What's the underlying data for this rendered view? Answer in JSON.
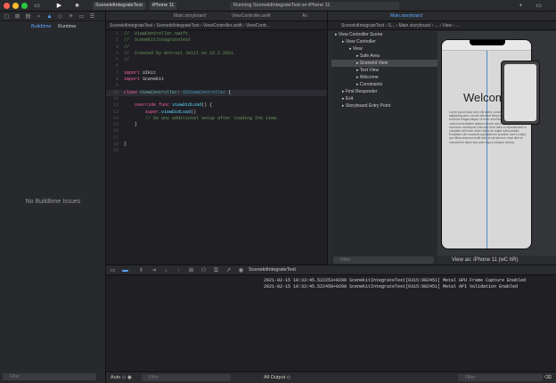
{
  "titlebar": {
    "scheme": "ScenekitIntegrateTest",
    "destination": "iPhone 11",
    "status": "Running ScenekitIntegrateTest on iPhone 11"
  },
  "navigator": {
    "tabs": [
      "Buildtime",
      "Runtime"
    ],
    "empty_message": "No Buildtime Issues",
    "filter_placeholder": "Filter"
  },
  "editor": {
    "tabs": [
      "Main.storyboard",
      "ViewController.swift",
      "As"
    ],
    "breadcrumbs": "ScenekitIntegrateTest  ›  ScenekitIntegrateTest  ›  ViewController.swift  ›  ViewContr...",
    "code": [
      {
        "n": "1",
        "parts": [
          [
            "cmt",
            "//  ViewController.swift"
          ]
        ]
      },
      {
        "n": "2",
        "parts": [
          [
            "cmt",
            "//  ScenekitIntegrateTest"
          ]
        ]
      },
      {
        "n": "3",
        "parts": [
          [
            "cmt",
            "//"
          ]
        ]
      },
      {
        "n": "4",
        "parts": [
          [
            "cmt",
            "//  Created by Antruzi Jalil on 15.2.2021."
          ]
        ]
      },
      {
        "n": "5",
        "parts": [
          [
            "cmt",
            "//"
          ]
        ]
      },
      {
        "n": "6",
        "parts": []
      },
      {
        "n": "7",
        "parts": [
          [
            "kw",
            "import"
          ],
          [
            "pl",
            " UIKit"
          ]
        ]
      },
      {
        "n": "8",
        "parts": [
          [
            "kw",
            "import"
          ],
          [
            "pl",
            " SceneKit"
          ]
        ]
      },
      {
        "n": "9",
        "parts": []
      },
      {
        "n": "10",
        "parts": [
          [
            "kw",
            "class"
          ],
          [
            "pl",
            " "
          ],
          [
            "fn",
            "ViewController"
          ],
          [
            "pl",
            ": "
          ],
          [
            "cls",
            "UIViewController"
          ],
          [
            "pl",
            " {"
          ]
        ],
        "hl": true
      },
      {
        "n": "11",
        "parts": []
      },
      {
        "n": "12",
        "parts": [
          [
            "pl",
            "    "
          ],
          [
            "kw",
            "override"
          ],
          [
            "pl",
            " "
          ],
          [
            "kw",
            "func"
          ],
          [
            "pl",
            " "
          ],
          [
            "typ",
            "viewDidLoad"
          ],
          [
            "pl",
            "() {"
          ]
        ]
      },
      {
        "n": "13",
        "parts": [
          [
            "pl",
            "        "
          ],
          [
            "kw",
            "super"
          ],
          [
            "pl",
            "."
          ],
          [
            "typ",
            "viewDidLoad"
          ],
          [
            "pl",
            "()"
          ]
        ]
      },
      {
        "n": "14",
        "parts": [
          [
            "pl",
            "        "
          ],
          [
            "cmt",
            "// Do any additional setup after loading the view."
          ]
        ]
      },
      {
        "n": "15",
        "parts": [
          [
            "pl",
            "    }"
          ]
        ]
      },
      {
        "n": "16",
        "parts": []
      },
      {
        "n": "17",
        "parts": []
      },
      {
        "n": "18",
        "parts": [
          [
            "pl",
            "}"
          ]
        ]
      },
      {
        "n": "19",
        "parts": []
      }
    ]
  },
  "ib": {
    "tab": "Main.storyboard",
    "breadcrumbs": "ScenekitIntegrateTest  ›  S...  ›  Main.storyboard  ›  ...  ›  View  ›  ...",
    "outline": [
      {
        "label": "View Controller Scene",
        "indent": 0
      },
      {
        "label": "View Controller",
        "indent": 1
      },
      {
        "label": "View",
        "indent": 2
      },
      {
        "label": "Safe Area",
        "indent": 3
      },
      {
        "label": "Scenekit View",
        "indent": 3,
        "sel": true
      },
      {
        "label": "Text View",
        "indent": 3
      },
      {
        "label": "Welcome",
        "indent": 3
      },
      {
        "label": "Constraints",
        "indent": 3
      },
      {
        "label": "First Responder",
        "indent": 1
      },
      {
        "label": "Exit",
        "indent": 1
      },
      {
        "label": "Storyboard Entry Point",
        "indent": 1
      }
    ],
    "filter_placeholder": "Filter",
    "welcome": "Welcome",
    "lorem": "Lorem ipsum dolor sit er elit lamet, consectetaur cillium adipisicing pecu, sed do eiusmod tempor incididunt ut labore et dolore magna aliqua. Ut enim ad minim veniam, quis nostrud exercitation ullamco laboris nisi ut aliquip ex ea commodo consequat. Duis aute irure dolor in reprehenderit in voluptate velit esse cillum dolore eu fugiat nulla pariatur. Excepteur sint occaecat cupidatat non proident, sunt in culpa qui officia deserunt mollit anim id est laborum. Nam liber te conscient to factor tum poen legum odioque civiuda.",
    "view_as": "View as: iPhone 11 (wC hR)"
  },
  "debug": {
    "scheme": "ScenekitIntegrateTest",
    "log": [
      "2021-02-15 10:33:45.522253+0200 ScenekitIntegrateTest[9315:982451] Metal GPU Frame Capture Enabled",
      "2021-02-15 10:33:45.522458+0200 ScenekitIntegrateTest[9315:982451] Metal API Validation Enabled"
    ],
    "auto": "Auto ◇",
    "all_output": "All Output ◇",
    "filter_placeholder": "Filter"
  }
}
